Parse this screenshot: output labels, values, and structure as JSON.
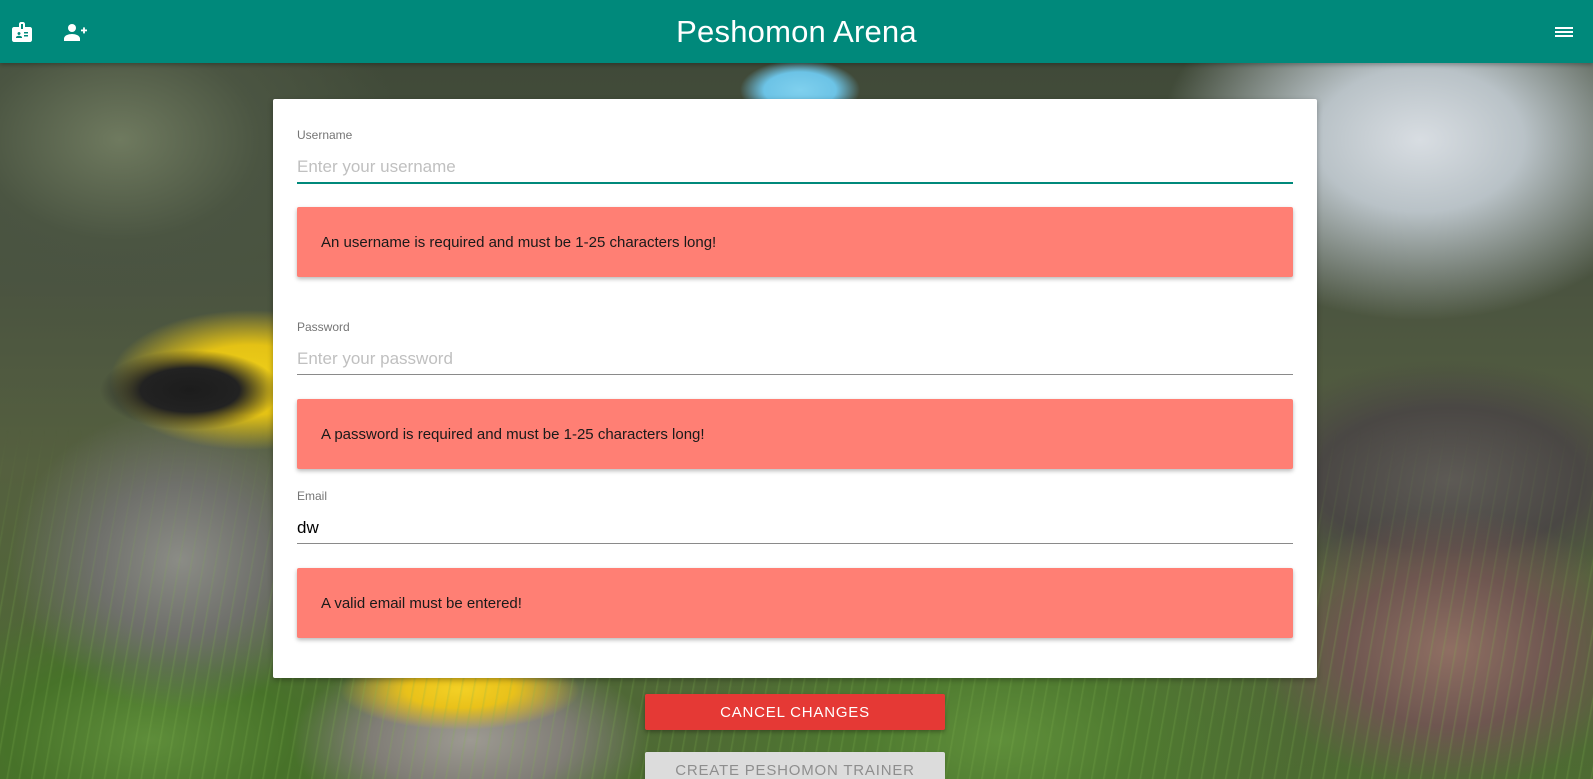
{
  "app": {
    "title": "Peshomon Arena",
    "colors": {
      "appbar": "#00897b",
      "error_box": "#ff7f74",
      "cancel_button": "#e53935",
      "disabled_button": "#dcdcdc"
    },
    "icons": {
      "left_1": "badge-icon",
      "left_2": "add-user-icon",
      "right": "menu-icon"
    }
  },
  "form": {
    "username": {
      "label": "Username",
      "placeholder": "Enter your username",
      "value": "",
      "error": "An username is required and must be 1-25 characters long!"
    },
    "password": {
      "label": "Password",
      "placeholder": "Enter your password",
      "value": "",
      "error": "A password is required and must be 1-25 characters long!"
    },
    "email": {
      "label": "Email",
      "placeholder": "",
      "value": "dw",
      "error": "A valid email must be entered!"
    }
  },
  "actions": {
    "cancel_label": "Cancel Changes",
    "create_label": "Create Peshomon Trainer"
  }
}
